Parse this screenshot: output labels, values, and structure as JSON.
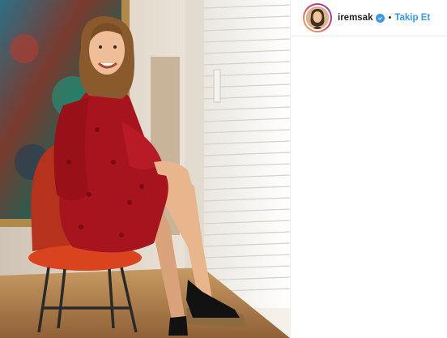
{
  "header": {
    "username": "iremsak",
    "separator": "•",
    "follow_label": "Takip Et"
  },
  "icons": {
    "verified": "verified-badge-icon"
  },
  "colors": {
    "link_blue": "#3897f0",
    "text_dark": "#262626"
  }
}
